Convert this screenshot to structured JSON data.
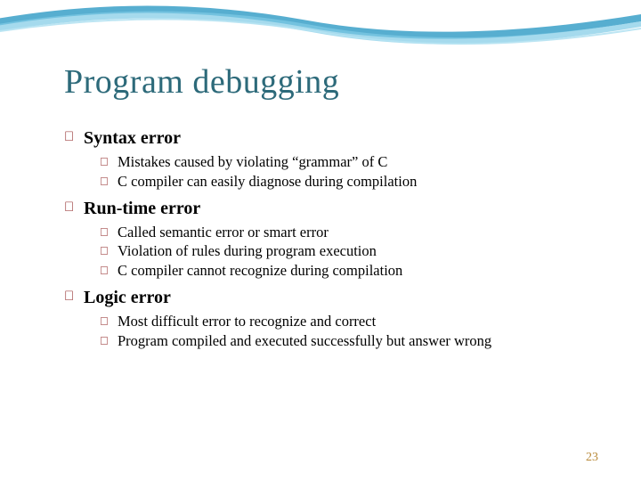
{
  "slide": {
    "title": "Program debugging",
    "sections": [
      {
        "heading": "Syntax error",
        "items": [
          "Mistakes caused by violating “grammar” of C",
          "C compiler can easily diagnose during compilation"
        ]
      },
      {
        "heading": "Run-time error",
        "items": [
          "Called semantic error or smart error",
          "Violation of rules during program execution",
          "C compiler cannot recognize during compilation"
        ]
      },
      {
        "heading": "Logic error",
        "items": [
          "Most difficult error to recognize and correct",
          "Program compiled and executed successfully but answer wrong"
        ]
      }
    ],
    "page_number": "23"
  }
}
